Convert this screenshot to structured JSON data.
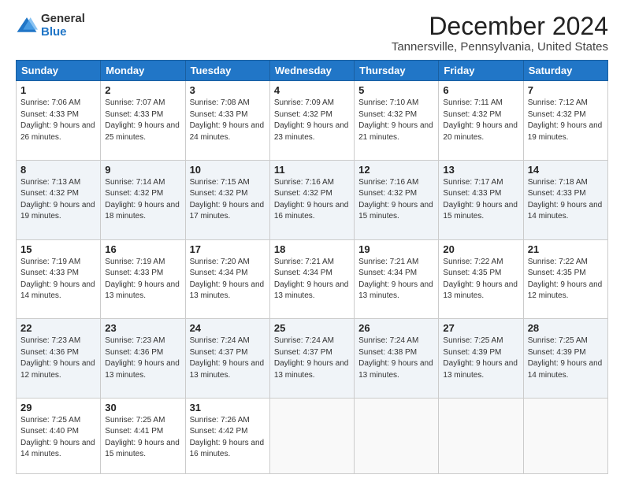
{
  "logo": {
    "general": "General",
    "blue": "Blue"
  },
  "title": "December 2024",
  "subtitle": "Tannersville, Pennsylvania, United States",
  "days_of_week": [
    "Sunday",
    "Monday",
    "Tuesday",
    "Wednesday",
    "Thursday",
    "Friday",
    "Saturday"
  ],
  "weeks": [
    [
      {
        "day": 1,
        "sunrise": "7:06 AM",
        "sunset": "4:33 PM",
        "daylight": "9 hours and 26 minutes."
      },
      {
        "day": 2,
        "sunrise": "7:07 AM",
        "sunset": "4:33 PM",
        "daylight": "9 hours and 25 minutes."
      },
      {
        "day": 3,
        "sunrise": "7:08 AM",
        "sunset": "4:33 PM",
        "daylight": "9 hours and 24 minutes."
      },
      {
        "day": 4,
        "sunrise": "7:09 AM",
        "sunset": "4:32 PM",
        "daylight": "9 hours and 23 minutes."
      },
      {
        "day": 5,
        "sunrise": "7:10 AM",
        "sunset": "4:32 PM",
        "daylight": "9 hours and 21 minutes."
      },
      {
        "day": 6,
        "sunrise": "7:11 AM",
        "sunset": "4:32 PM",
        "daylight": "9 hours and 20 minutes."
      },
      {
        "day": 7,
        "sunrise": "7:12 AM",
        "sunset": "4:32 PM",
        "daylight": "9 hours and 19 minutes."
      }
    ],
    [
      {
        "day": 8,
        "sunrise": "7:13 AM",
        "sunset": "4:32 PM",
        "daylight": "9 hours and 19 minutes."
      },
      {
        "day": 9,
        "sunrise": "7:14 AM",
        "sunset": "4:32 PM",
        "daylight": "9 hours and 18 minutes."
      },
      {
        "day": 10,
        "sunrise": "7:15 AM",
        "sunset": "4:32 PM",
        "daylight": "9 hours and 17 minutes."
      },
      {
        "day": 11,
        "sunrise": "7:16 AM",
        "sunset": "4:32 PM",
        "daylight": "9 hours and 16 minutes."
      },
      {
        "day": 12,
        "sunrise": "7:16 AM",
        "sunset": "4:32 PM",
        "daylight": "9 hours and 15 minutes."
      },
      {
        "day": 13,
        "sunrise": "7:17 AM",
        "sunset": "4:33 PM",
        "daylight": "9 hours and 15 minutes."
      },
      {
        "day": 14,
        "sunrise": "7:18 AM",
        "sunset": "4:33 PM",
        "daylight": "9 hours and 14 minutes."
      }
    ],
    [
      {
        "day": 15,
        "sunrise": "7:19 AM",
        "sunset": "4:33 PM",
        "daylight": "9 hours and 14 minutes."
      },
      {
        "day": 16,
        "sunrise": "7:19 AM",
        "sunset": "4:33 PM",
        "daylight": "9 hours and 13 minutes."
      },
      {
        "day": 17,
        "sunrise": "7:20 AM",
        "sunset": "4:34 PM",
        "daylight": "9 hours and 13 minutes."
      },
      {
        "day": 18,
        "sunrise": "7:21 AM",
        "sunset": "4:34 PM",
        "daylight": "9 hours and 13 minutes."
      },
      {
        "day": 19,
        "sunrise": "7:21 AM",
        "sunset": "4:34 PM",
        "daylight": "9 hours and 13 minutes."
      },
      {
        "day": 20,
        "sunrise": "7:22 AM",
        "sunset": "4:35 PM",
        "daylight": "9 hours and 13 minutes."
      },
      {
        "day": 21,
        "sunrise": "7:22 AM",
        "sunset": "4:35 PM",
        "daylight": "9 hours and 12 minutes."
      }
    ],
    [
      {
        "day": 22,
        "sunrise": "7:23 AM",
        "sunset": "4:36 PM",
        "daylight": "9 hours and 12 minutes."
      },
      {
        "day": 23,
        "sunrise": "7:23 AM",
        "sunset": "4:36 PM",
        "daylight": "9 hours and 13 minutes."
      },
      {
        "day": 24,
        "sunrise": "7:24 AM",
        "sunset": "4:37 PM",
        "daylight": "9 hours and 13 minutes."
      },
      {
        "day": 25,
        "sunrise": "7:24 AM",
        "sunset": "4:37 PM",
        "daylight": "9 hours and 13 minutes."
      },
      {
        "day": 26,
        "sunrise": "7:24 AM",
        "sunset": "4:38 PM",
        "daylight": "9 hours and 13 minutes."
      },
      {
        "day": 27,
        "sunrise": "7:25 AM",
        "sunset": "4:39 PM",
        "daylight": "9 hours and 13 minutes."
      },
      {
        "day": 28,
        "sunrise": "7:25 AM",
        "sunset": "4:39 PM",
        "daylight": "9 hours and 14 minutes."
      }
    ],
    [
      {
        "day": 29,
        "sunrise": "7:25 AM",
        "sunset": "4:40 PM",
        "daylight": "9 hours and 14 minutes."
      },
      {
        "day": 30,
        "sunrise": "7:25 AM",
        "sunset": "4:41 PM",
        "daylight": "9 hours and 15 minutes."
      },
      {
        "day": 31,
        "sunrise": "7:26 AM",
        "sunset": "4:42 PM",
        "daylight": "9 hours and 16 minutes."
      },
      null,
      null,
      null,
      null
    ]
  ],
  "labels": {
    "sunrise": "Sunrise:",
    "sunset": "Sunset:",
    "daylight": "Daylight:"
  }
}
